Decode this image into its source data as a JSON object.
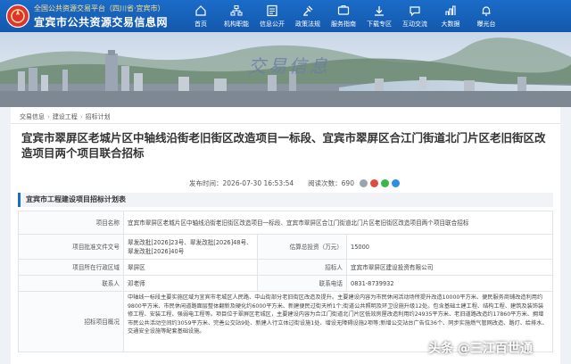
{
  "header": {
    "brand_top": "全国公共资源交易平台（四川省·宜宾市）",
    "brand_main": "宜宾市公共资源交易信息网",
    "nav": [
      {
        "label": "首页",
        "icon": "home-icon"
      },
      {
        "label": "机构职能",
        "icon": "org-icon"
      },
      {
        "label": "信息公开",
        "icon": "info-icon"
      },
      {
        "label": "政策法规",
        "icon": "law-icon"
      },
      {
        "label": "服务指南",
        "icon": "guide-icon"
      },
      {
        "label": "下载专区",
        "icon": "download-icon"
      },
      {
        "label": "互动交流",
        "icon": "chat-icon"
      },
      {
        "label": "大数据",
        "icon": "bigdata-icon"
      },
      {
        "label": "曝光台",
        "icon": "bell-icon"
      }
    ]
  },
  "banner": {
    "title": "交易信息"
  },
  "breadcrumb": [
    "交易信息",
    "建设工程",
    "招标计划"
  ],
  "article": {
    "title": "宜宾市翠屏区老城片区中轴线沿街老旧街区改造项目一标段、宜宾市翠屏区合江门街道北门片区老旧街区改造项目两个项目联合招标",
    "publish_label": "发布时间：",
    "publish_time": "2026-07-30 16:53:54",
    "views_label": "阅读次数：",
    "views": "690"
  },
  "section": {
    "title": "宜宾市工程建设项目招标计划表"
  },
  "table": {
    "project_name_label": "项目名称",
    "project_name": "宜宾市翠屏区老城片区中轴线沿街老旧街区改造项目一标段、宜宾市翠屏区合江门街道北门片区老旧街区改造项目两个项目联合招标",
    "approval_label": "项目批准文件文号",
    "approval_value": "翠发改批[2026]23号、翠发改批[2026]48号、翠发改批[2026]40号",
    "invest_label": "估算总投资（万元）",
    "invest_value": "15000",
    "region_label": "项目所在行政区域",
    "region_value": "翠屏区",
    "tenderee_label": "招标人",
    "tenderee_value": "宜宾市翠屏区建设投资有限公司",
    "contact_label": "联系人",
    "contact_value": "邓老师",
    "phone_label": "联系电话",
    "phone_value": "0831-8739932",
    "overview_label": "招标项目概况",
    "overview_text": "中轴线一标段主要实施区域为宜宾市老城区人民路、中山街部分老旧街区改造及提升。主要建设内容为市民休闲活动场所提升改造10000平方米、便民服务商铺改造利用约9800平方米、市民休闲道路面层整体翻新及硬化约6000平方米、新建便民过街天桥1个;街道公共照明及环卫设施升级12处。包含基础土建工程、结构工程、建筑及装饰装修工程、安装工程、强弱电工程等。项目位于翠屏区老城区，主要建设内容为合江门街道北门片区低效房屋改造利用约24935平方米、老旧道路改造约17860平方米、拥增市民公共活动空间约3059平方米、完善公交站9处、新建人行立体过街设施1处、增设无障碍设施2项等;新增公交站台广告位36个、同步实施燃气管网改造、路灯、给排水、交通安全设施等配套基础设施。"
  },
  "watermark": "头条 @三江百世通",
  "colors": {
    "header": "#1660b8",
    "accent": "#1a6cc8",
    "brand_top": "#ffe08a"
  }
}
